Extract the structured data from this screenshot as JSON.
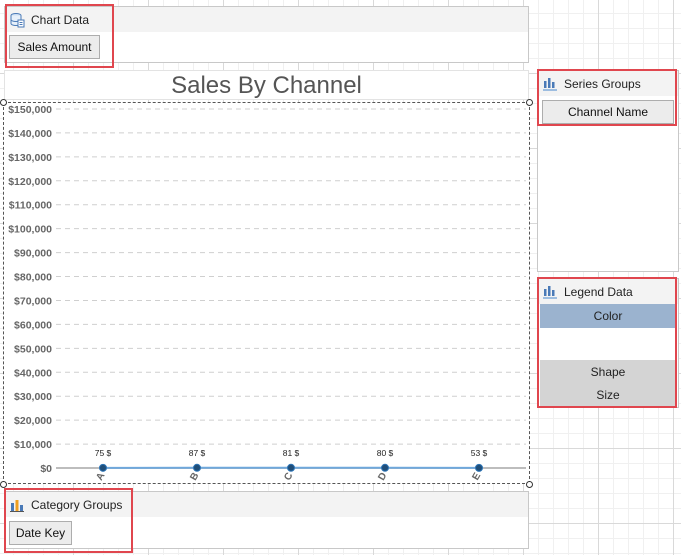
{
  "chart_data_panel": {
    "title": "Chart Data",
    "button_label": "Sales Amount"
  },
  "category_groups_panel": {
    "title": "Category Groups",
    "button_label": "Date Key"
  },
  "series_groups_panel": {
    "title": "Series Groups",
    "button_label": "Channel Name"
  },
  "legend_data_panel": {
    "title": "Legend Data",
    "rows": [
      "Color",
      "",
      "Shape",
      "Size"
    ]
  },
  "colors": {
    "accent": "#e0464e",
    "line": "#6fa8dc",
    "point": "#1f4e79",
    "legend_selected": "#9bb3cf",
    "legend_disabled": "#d4d4d4"
  },
  "chart_data": {
    "type": "line",
    "title": "Sales By Channel",
    "categories": [
      "A",
      "B",
      "C",
      "D",
      "E"
    ],
    "values": [
      75,
      87,
      81,
      80,
      53
    ],
    "data_labels": [
      "75 $",
      "87 $",
      "81 $",
      "80 $",
      "53 $"
    ],
    "y_ticks": [
      "$0",
      "$10,000",
      "$20,000",
      "$30,000",
      "$40,000",
      "$50,000",
      "$60,000",
      "$70,000",
      "$80,000",
      "$90,000",
      "$100,000",
      "$110,000",
      "$120,000",
      "$130,000",
      "$140,000",
      "$150,000"
    ],
    "ylim": [
      0,
      150000
    ],
    "y_step": 10000,
    "grid": true
  }
}
